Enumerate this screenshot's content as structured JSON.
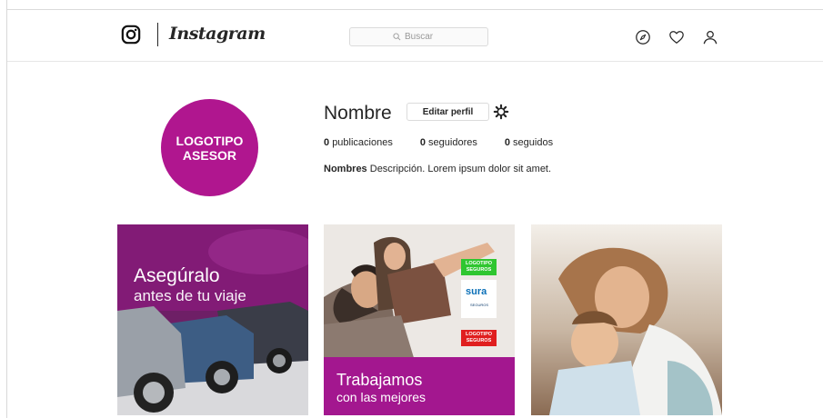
{
  "nav": {
    "brand": "Instagram",
    "search": {
      "placeholder": "Buscar",
      "value": ""
    }
  },
  "profile": {
    "avatar_lines": [
      "LOGOTIPO",
      "ASESOR"
    ],
    "name": "Nombre",
    "edit_label": "Editar perfil",
    "stats": [
      {
        "count": "0",
        "label": "publicaciones"
      },
      {
        "count": "0",
        "label": "seguidores"
      },
      {
        "count": "0",
        "label": "seguidos"
      }
    ],
    "bio_name": "Nombres",
    "bio_text": "Descripción. Lorem ipsum dolor sit amet."
  },
  "posts": [
    {
      "title": "Asegúralo",
      "subtitle": "antes de tu viaje"
    },
    {
      "title": "Trabajamos",
      "subtitle": "con las mejores",
      "logo_top": [
        "LOGOTIPO",
        "SEGUROS"
      ],
      "partner_logo": "sura",
      "partner_sub": "SEGUROS",
      "logo_bottom": [
        "LOGOTIPO",
        "SEGUROS"
      ]
    },
    {}
  ],
  "colors": {
    "accent": "#b0168f",
    "band": "#a3178f",
    "green_tag": "#2fc630",
    "red_tag": "#e01f1f"
  }
}
